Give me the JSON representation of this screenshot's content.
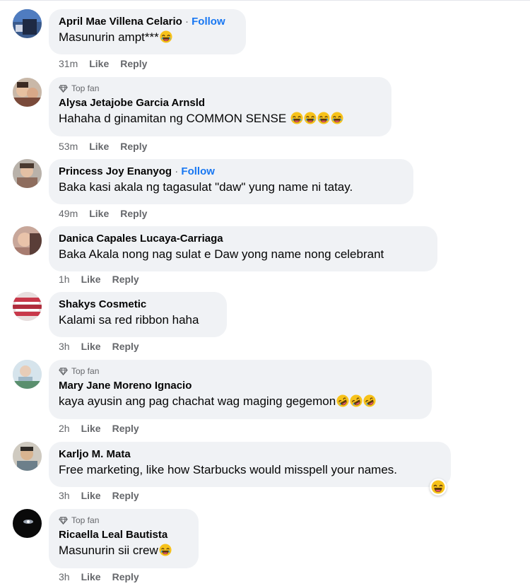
{
  "comments": [
    {
      "author": "April Mae Villena Celario",
      "follow": "Follow",
      "text": "Masunurin ampt***",
      "time": "31m",
      "like": "Like",
      "reply": "Reply"
    },
    {
      "badge": "Top fan",
      "author": "Alysa Jetajobe Garcia Arnsld",
      "text": "Hahaha d ginamitan ng COMMON SENSE",
      "time": "53m",
      "like": "Like",
      "reply": "Reply"
    },
    {
      "author": "Princess Joy Enanyog",
      "follow": "Follow",
      "text": "Baka kasi akala ng tagasulat \"daw\" yung name ni tatay.",
      "time": "49m",
      "like": "Like",
      "reply": "Reply"
    },
    {
      "author": "Danica Capales Lucaya-Carriaga",
      "text": "Baka Akala nong nag sulat e Daw yong name nong celebrant",
      "time": "1h",
      "like": "Like",
      "reply": "Reply"
    },
    {
      "author": "Shakys Cosmetic",
      "text": "Kalami sa red ribbon haha",
      "time": "3h",
      "like": "Like",
      "reply": "Reply"
    },
    {
      "badge": "Top fan",
      "author": "Mary Jane Moreno Ignacio",
      "text": "kaya ayusin ang pag chachat wag maging gegemon",
      "time": "2h",
      "like": "Like",
      "reply": "Reply"
    },
    {
      "author": "Karljo M. Mata",
      "text": "Free marketing, like how Starbucks would misspell your names.",
      "time": "3h",
      "like": "Like",
      "reply": "Reply"
    },
    {
      "badge": "Top fan",
      "author": "Ricaella Leal Bautista",
      "text": "Masunurin sii crew",
      "time": "3h",
      "like": "Like",
      "reply": "Reply"
    }
  ]
}
